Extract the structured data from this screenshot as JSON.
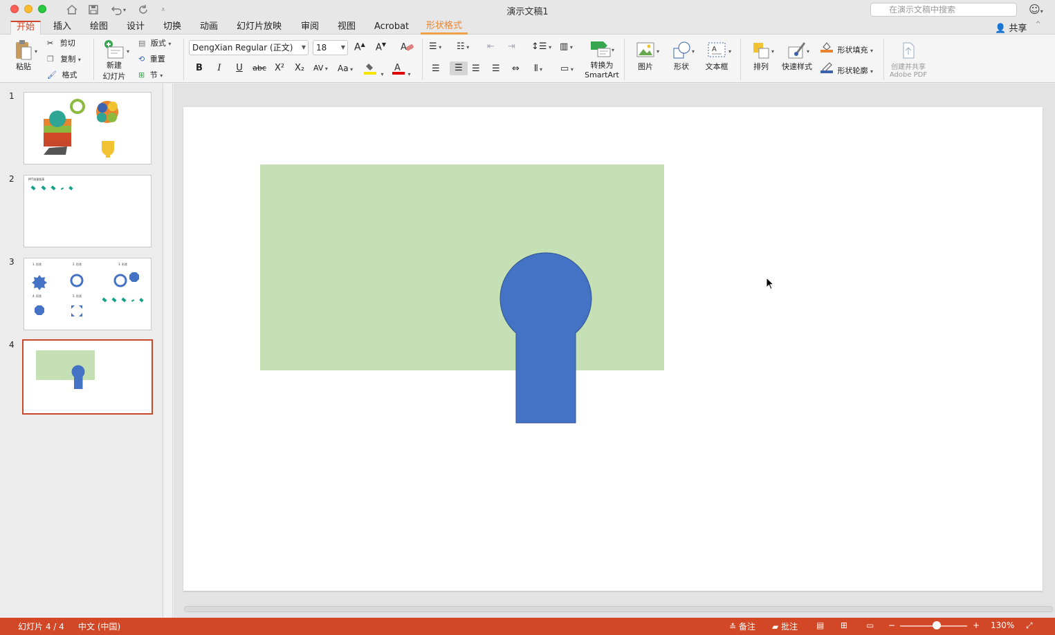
{
  "window": {
    "title": "演示文稿1",
    "search_placeholder": "在演示文稿中搜索"
  },
  "tabs": [
    {
      "label": "开始",
      "active": true
    },
    {
      "label": "插入"
    },
    {
      "label": "绘图"
    },
    {
      "label": "设计"
    },
    {
      "label": "切换"
    },
    {
      "label": "动画"
    },
    {
      "label": "幻灯片放映"
    },
    {
      "label": "审阅"
    },
    {
      "label": "视图"
    },
    {
      "label": "Acrobat"
    },
    {
      "label": "形状格式",
      "contextual": true
    }
  ],
  "share_label": "共享",
  "ribbon": {
    "paste": "粘贴",
    "cut": "剪切",
    "copy": "复制",
    "format_painter": "格式",
    "new_slide_line1": "新建",
    "new_slide_line2": "幻灯片",
    "layout": "版式",
    "reset": "重置",
    "section": "节",
    "font_name": "DengXian Regular (正文)",
    "font_size": "18",
    "bold": "B",
    "italic": "I",
    "underline": "U",
    "strike": "abc",
    "superscript": "X²",
    "subscript": "X₂",
    "convert_line1": "转换为",
    "convert_line2": "SmartArt",
    "picture": "图片",
    "shapes": "形状",
    "textbox": "文本框",
    "arrange": "排列",
    "quick_styles": "快速样式",
    "shape_fill": "形状填充",
    "shape_outline": "形状轮廓",
    "adobe_line1": "创建并共享",
    "adobe_line2": "Adobe PDF"
  },
  "slides": [
    {
      "number": "1"
    },
    {
      "number": "2",
      "caption": "PPT创意图表"
    },
    {
      "number": "3",
      "labels": [
        "1. 形状",
        "2. 形状",
        "3. 形状",
        "4. 形状",
        "5. 形状"
      ]
    },
    {
      "number": "4",
      "selected": true
    }
  ],
  "colors": {
    "accent": "#d24726",
    "rect_fill": "#c5e0b4",
    "keyhole_fill": "#4472c4",
    "keyhole_stroke": "#2f528f"
  },
  "status": {
    "slide_info": "幻灯片 4 / 4",
    "language": "中文 (中国)",
    "notes": "备注",
    "comments": "批注",
    "zoom": "130%"
  }
}
